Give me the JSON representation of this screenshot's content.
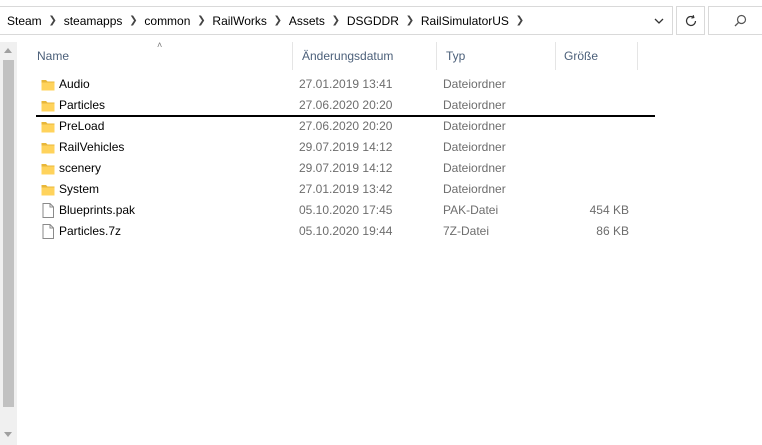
{
  "breadcrumb": [
    "Steam",
    "steamapps",
    "common",
    "RailWorks",
    "Assets",
    "DSGDDR",
    "RailSimulatorUS"
  ],
  "columns": {
    "name": "Name",
    "date": "Änderungsdatum",
    "type": "Typ",
    "size": "Größe"
  },
  "files": [
    {
      "name": "Audio",
      "date": "27.01.2019 13:41",
      "type": "Dateiordner",
      "size": "",
      "icon": "folder-icon"
    },
    {
      "name": "Particles",
      "date": "27.06.2020 20:20",
      "type": "Dateiordner",
      "size": "",
      "icon": "folder-icon"
    },
    {
      "name": "PreLoad",
      "date": "27.06.2020 20:20",
      "type": "Dateiordner",
      "size": "",
      "icon": "folder-icon"
    },
    {
      "name": "RailVehicles",
      "date": "29.07.2019 14:12",
      "type": "Dateiordner",
      "size": "",
      "icon": "folder-icon"
    },
    {
      "name": "scenery",
      "date": "29.07.2019 14:12",
      "type": "Dateiordner",
      "size": "",
      "icon": "folder-icon"
    },
    {
      "name": "System",
      "date": "27.01.2019 13:42",
      "type": "Dateiordner",
      "size": "",
      "icon": "folder-icon"
    },
    {
      "name": "Blueprints.pak",
      "date": "05.10.2020 17:45",
      "type": "PAK-Datei",
      "size": "454 KB",
      "icon": "file-icon"
    },
    {
      "name": "Particles.7z",
      "date": "05.10.2020 19:44",
      "type": "7Z-Datei",
      "size": "86 KB",
      "icon": "file-icon"
    }
  ],
  "colors": {
    "folder": "#ffd35c",
    "folder_dark": "#e8b73a",
    "header_text": "#4c607a",
    "meta_text": "#6d6d6d"
  }
}
